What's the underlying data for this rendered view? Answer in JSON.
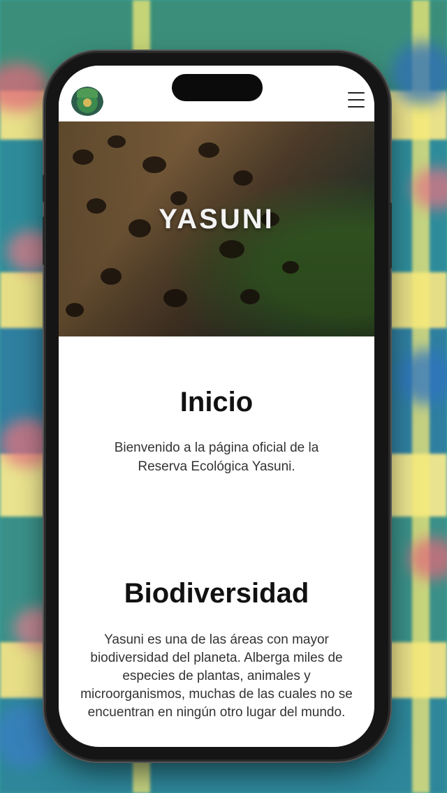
{
  "app": {
    "hero_title": "YASUNI",
    "logo_icon": "jungle-emblem-logo",
    "menu_icon": "hamburger-menu-icon"
  },
  "sections": [
    {
      "title": "Inicio",
      "text": "Bienvenido a la página oficial de la Reserva Ecológica Yasuni."
    },
    {
      "title": "Biodiversidad",
      "text": "Yasuni es una de las áreas con mayor biodiversidad del planeta. Alberga miles de especies de plantas, animales y microorganismos, muchas de las cuales no se encuentran en ningún otro lugar del mundo."
    }
  ],
  "colors": {
    "screen_bg": "#ffffff",
    "text_dark": "#111111",
    "phone_frame": "#151515"
  }
}
